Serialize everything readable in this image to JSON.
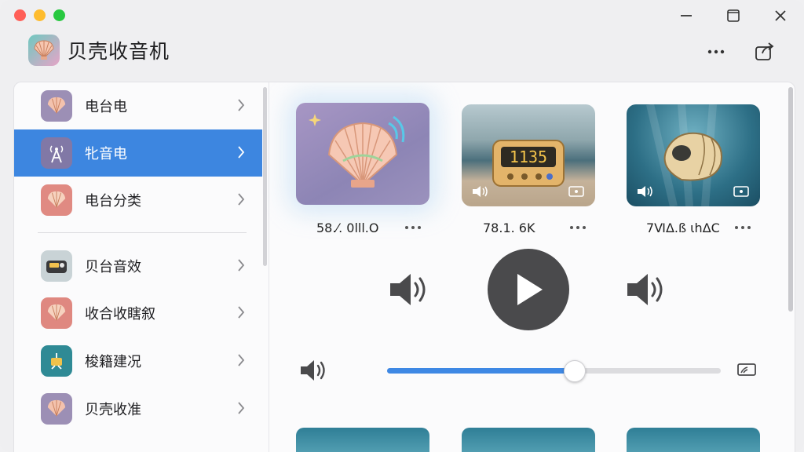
{
  "app": {
    "title": "贝壳收音机"
  },
  "sidebar": {
    "items": [
      {
        "label": "电台电",
        "icon": "shell-icon",
        "active": false
      },
      {
        "label": "牝音电",
        "icon": "radio-tower-icon",
        "active": true
      },
      {
        "label": "电台分类",
        "icon": "shell-icon",
        "active": false
      },
      {
        "label": "贝台音效",
        "icon": "radio-device-icon",
        "active": false
      },
      {
        "label": "收合收瞎叙",
        "icon": "shell-icon",
        "active": false
      },
      {
        "label": "梭籍建况",
        "icon": "antenna-icon",
        "active": false
      },
      {
        "label": "贝壳收准",
        "icon": "shell-icon",
        "active": false
      }
    ]
  },
  "stations": [
    {
      "label": "58.⁄. 0lll.O"
    },
    {
      "label": "78.1. 6K"
    },
    {
      "label": "7ⅥΔ.ß ιhΔC"
    }
  ],
  "player": {
    "volume_fraction": 0.56
  },
  "colors": {
    "accent": "#3d86e0",
    "play": "#4a4a4c"
  }
}
